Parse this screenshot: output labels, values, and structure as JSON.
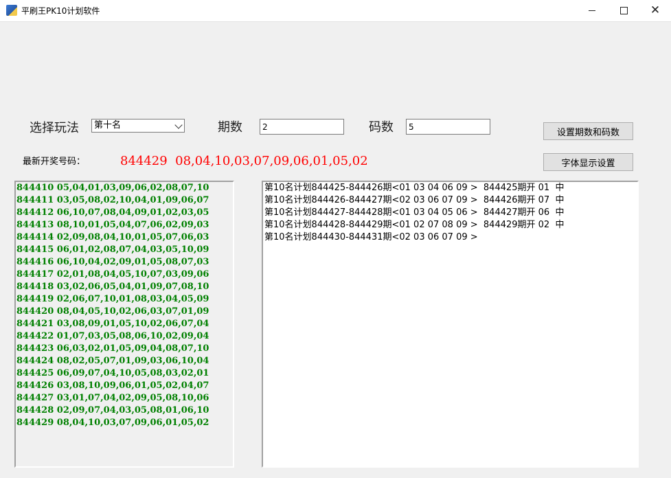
{
  "window": {
    "title": "平刷王PK10计划软件"
  },
  "controls": {
    "play_label": "选择玩法",
    "play_selected": "第十名",
    "periods_label": "期数",
    "periods_value": "2",
    "codes_label": "码数",
    "codes_value": "5",
    "set_button": "设置期数和码数",
    "font_button": "字体显示设置"
  },
  "latest": {
    "label": "最新开奖号码：",
    "value": "844429  08,04,10,03,07,09,06,01,05,02",
    "color": "#ff0000"
  },
  "history": [
    "844410 05,04,01,03,09,06,02,08,07,10",
    "844411 03,05,08,02,10,04,01,09,06,07",
    "844412 06,10,07,08,04,09,01,02,03,05",
    "844413 08,10,01,05,04,07,06,02,09,03",
    "844414 02,09,08,04,10,01,05,07,06,03",
    "844415 06,01,02,08,07,04,03,05,10,09",
    "844416 06,10,04,02,09,01,05,08,07,03",
    "844417 02,01,08,04,05,10,07,03,09,06",
    "844418 03,02,06,05,04,01,09,07,08,10",
    "844419 02,06,07,10,01,08,03,04,05,09",
    "844420 08,04,05,10,02,06,03,07,01,09",
    "844421 03,08,09,01,05,10,02,06,07,04",
    "844422 01,07,03,05,08,06,10,02,09,04",
    "844423 06,03,02,01,05,09,04,08,07,10",
    "844424 08,02,05,07,01,09,03,06,10,04",
    "844425 06,09,07,04,10,05,08,03,02,01",
    "844426 03,08,10,09,06,01,05,02,04,07",
    "844427 03,01,07,04,02,09,05,08,10,06",
    "844428 02,09,07,04,03,05,08,01,06,10",
    "844429 08,04,10,03,07,09,06,01,05,02"
  ],
  "history_color": "#008000",
  "plans": [
    "第10名计划844425-844426期<01 03 04 06 09 >  844425期开 01  中",
    "第10名计划844426-844427期<02 03 06 07 09 >  844426期开 07  中",
    "第10名计划844427-844428期<01 03 04 05 06 >  844427期开 06  中",
    "第10名计划844428-844429期<01 02 07 08 09 >  844429期开 02  中",
    "第10名计划844430-844431期<02 03 06 07 09 >"
  ]
}
